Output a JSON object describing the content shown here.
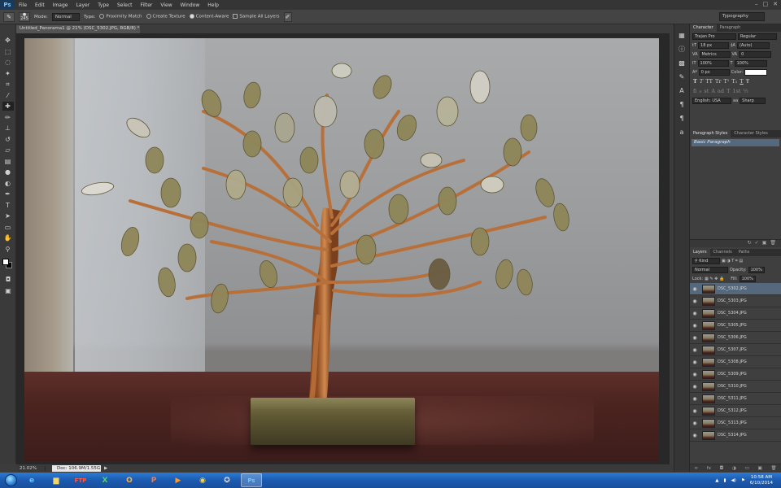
{
  "app": {
    "logo": "Ps"
  },
  "menu": [
    "File",
    "Edit",
    "Image",
    "Layer",
    "Type",
    "Select",
    "Filter",
    "View",
    "Window",
    "Help"
  ],
  "window_buttons": [
    "–",
    "□",
    "✕"
  ],
  "options": {
    "brush_size": "245",
    "mode_label": "Mode:",
    "mode_value": "Normal",
    "type_label": "Type:",
    "type_options": [
      "Proximity Match",
      "Create Texture",
      "Content-Aware"
    ],
    "sample_all_layers": "Sample All Layers",
    "workspace": "Typography"
  },
  "document": {
    "tab_title": "Untitled_Panorama1 @ 21% (DSC_5302.JPG, RGB/8) *",
    "close": "×"
  },
  "status": {
    "zoom": "21.02%",
    "doc": "Doc: 106.9M/1.55G"
  },
  "character_panel": {
    "tabs": [
      "Character",
      "Paragraph"
    ],
    "font_family": "Trajan Pro",
    "font_style": "Regular",
    "font_size": "18 px",
    "leading": "(Auto)",
    "kerning": "Metrics",
    "tracking": "0",
    "vertical_scale": "100%",
    "horizontal_scale": "100%",
    "baseline_shift": "0 px",
    "color_label": "Color:",
    "type_styles": [
      "T",
      "T",
      "TT",
      "Tr",
      "T¹",
      "T₁",
      "T",
      "Ŧ"
    ],
    "opentype": [
      "fi",
      "ℴ",
      "st",
      "A",
      "ad",
      "T",
      "1st",
      "½"
    ],
    "language": "English: USA",
    "aa_label": "a",
    "antialias": "Sharp",
    "aa_prefix": "aa"
  },
  "paragraph_styles": {
    "tabs": [
      "Paragraph Styles",
      "Character Styles"
    ],
    "item": "Basic Paragraph"
  },
  "layers_panel": {
    "tabs": [
      "Layers",
      "Channels",
      "Paths"
    ],
    "filter_kind": "Kind",
    "blend_mode": "Normal",
    "opacity_label": "Opacity:",
    "opacity": "100%",
    "lock_label": "Lock:",
    "fill_label": "Fill:",
    "fill": "100%",
    "layers": [
      "DSC_5302.JPG",
      "DSC_5303.JPG",
      "DSC_5304.JPG",
      "DSC_5305.JPG",
      "DSC_5306.JPG",
      "DSC_5307.JPG",
      "DSC_5308.JPG",
      "DSC_5309.JPG",
      "DSC_5310.JPG",
      "DSC_5311.JPG",
      "DSC_5312.JPG",
      "DSC_5313.JPG",
      "DSC_5314.JPG"
    ]
  },
  "taskbar": {
    "apps": [
      "ie-icon",
      "explorer-icon",
      "filezilla-icon",
      "excel-icon",
      "outlook-icon",
      "powerpoint-icon",
      "media-player-icon",
      "chrome-icon",
      "app-icon",
      "photoshop-icon"
    ],
    "time": "10:58 AM",
    "date": "6/10/2014"
  },
  "colors": {
    "accent": "#56687c",
    "taskbar": "#1c5ab0",
    "photoshop_blue": "#7fc4f6"
  }
}
